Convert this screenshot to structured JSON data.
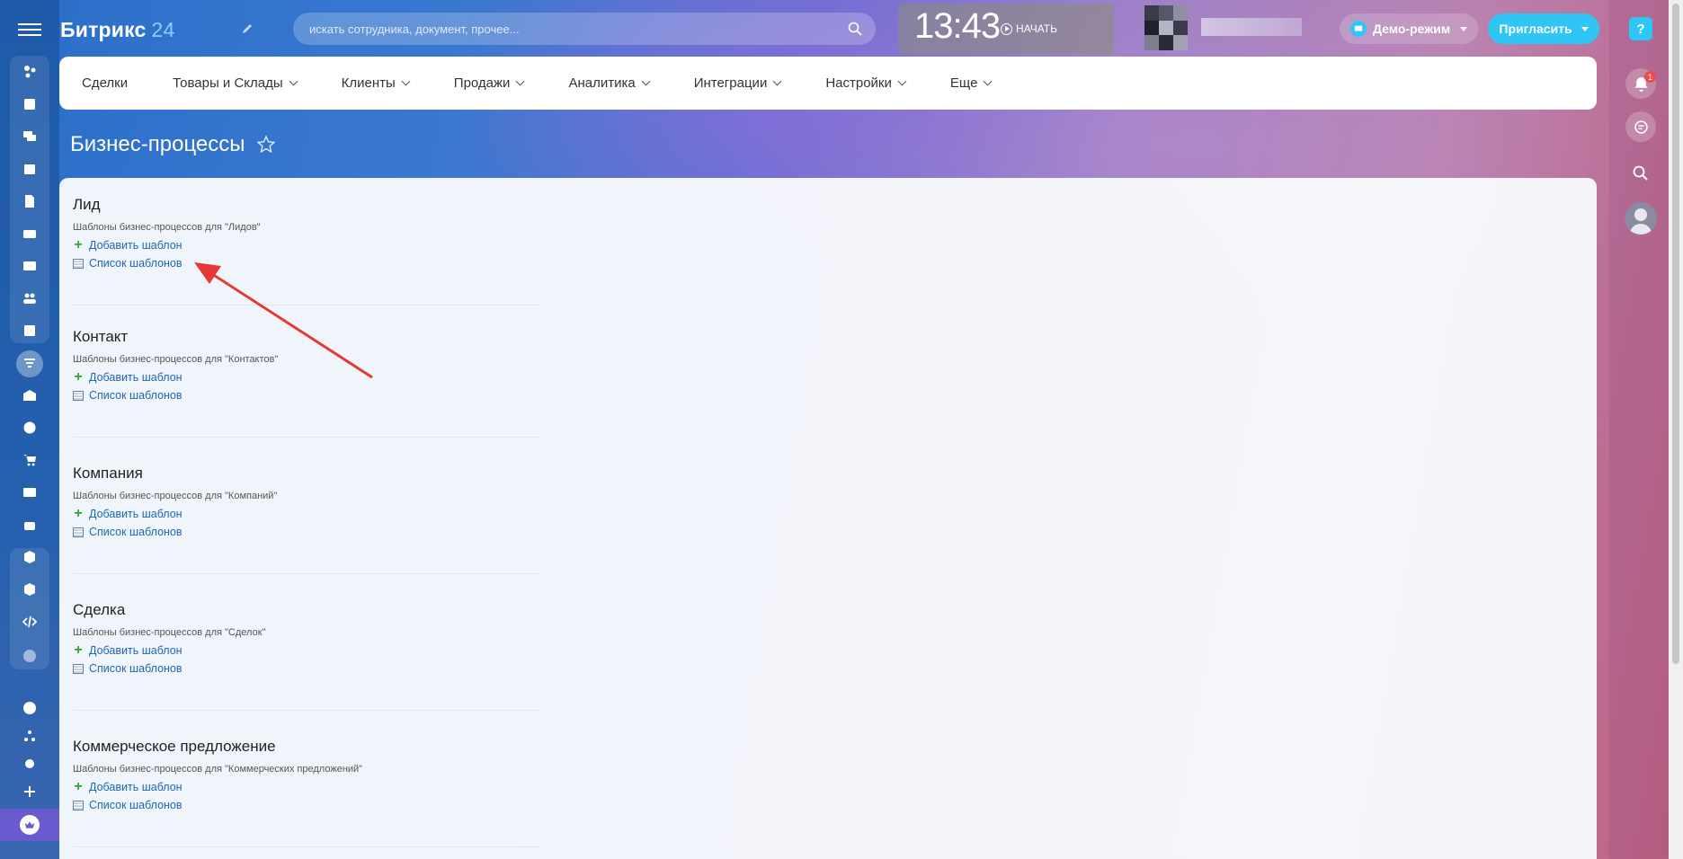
{
  "header": {
    "logo": "Битрикс",
    "logo_num": "24",
    "search_placeholder": "искать сотрудника, документ, прочее...",
    "clock": "13:43",
    "start_label": "НАЧАТЬ",
    "demo_label": "Демо-режим",
    "invite_label": "Пригласить",
    "notifications_count": "1",
    "help_label": "?"
  },
  "nav": {
    "items": [
      {
        "label": "Сделки",
        "dropdown": false
      },
      {
        "label": "Товары и Склады",
        "dropdown": true
      },
      {
        "label": "Клиенты",
        "dropdown": true
      },
      {
        "label": "Продажи",
        "dropdown": true
      },
      {
        "label": "Аналитика",
        "dropdown": true
      },
      {
        "label": "Интеграции",
        "dropdown": true
      },
      {
        "label": "Настройки",
        "dropdown": true
      },
      {
        "label": "Еще",
        "dropdown": true
      }
    ]
  },
  "page": {
    "title": "Бизнес-процессы"
  },
  "sections": [
    {
      "title": "Лид",
      "desc": "Шаблоны бизнес-процессов для \"Лидов\"",
      "add": "Добавить шаблон",
      "list": "Список шаблонов"
    },
    {
      "title": "Контакт",
      "desc": "Шаблоны бизнес-процессов для \"Контактов\"",
      "add": "Добавить шаблон",
      "list": "Список шаблонов"
    },
    {
      "title": "Компания",
      "desc": "Шаблоны бизнес-процессов для \"Компаний\"",
      "add": "Добавить шаблон",
      "list": "Список шаблонов"
    },
    {
      "title": "Сделка",
      "desc": "Шаблоны бизнес-процессов для \"Сделок\"",
      "add": "Добавить шаблон",
      "list": "Список шаблонов"
    },
    {
      "title": "Коммерческое предложение",
      "desc": "Шаблоны бизнес-процессов для \"Коммерческих предложений\"",
      "add": "Добавить шаблон",
      "list": "Список шаблонов"
    }
  ],
  "colors": {
    "accent": "#2fc6f6",
    "link": "#2067b0",
    "plus": "#2ea82e",
    "annotation_arrow": "#e53935"
  }
}
